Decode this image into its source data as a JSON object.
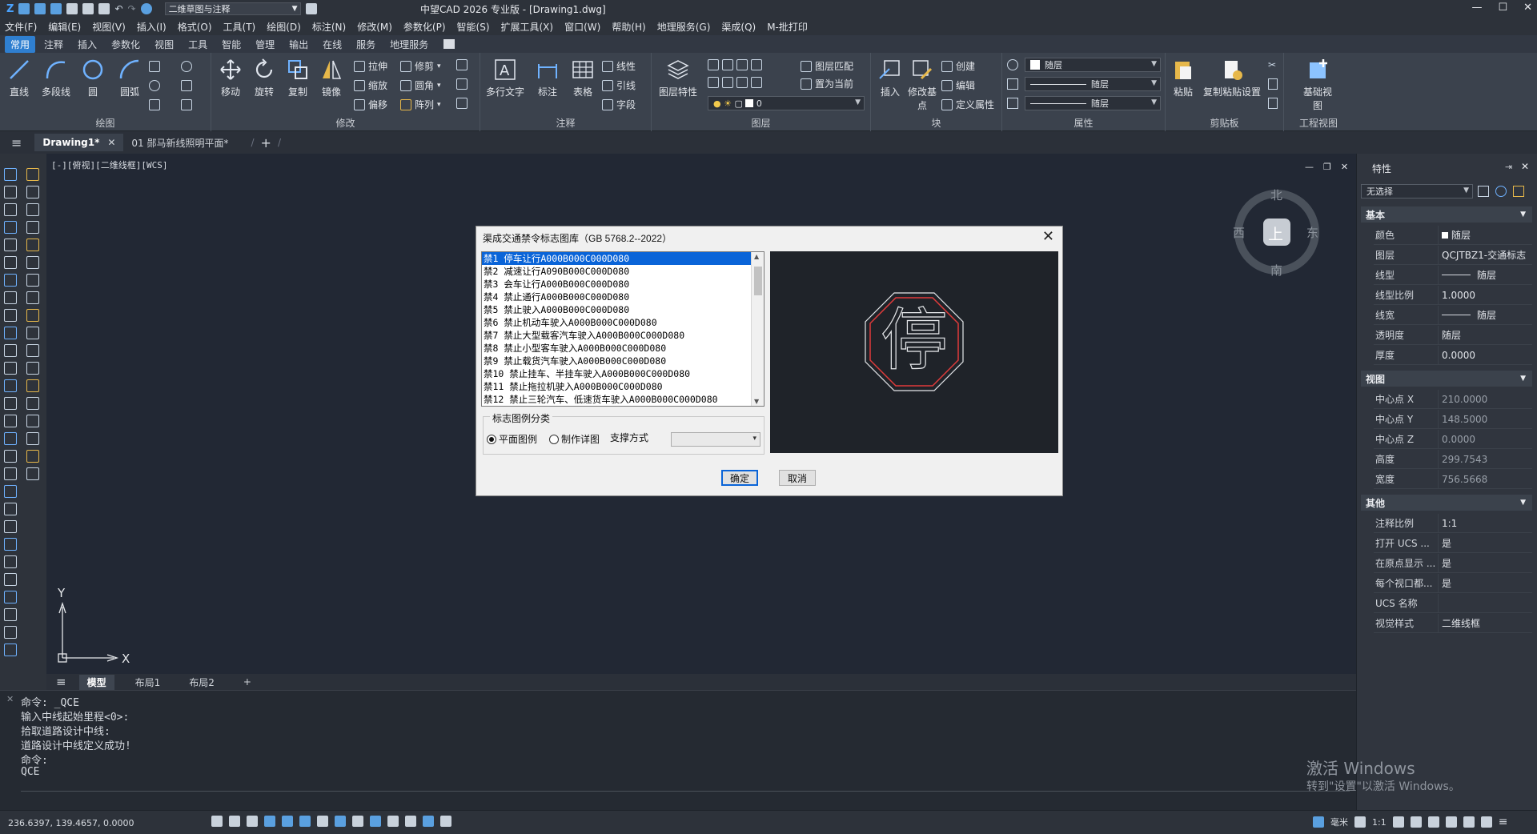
{
  "titlebar": {
    "workspace": "二维草图与注释",
    "title": "中望CAD 2026 专业版 - [Drawing1.dwg]",
    "win_min": "—",
    "win_max": "☐",
    "win_close": "✕"
  },
  "menubar": {
    "items": [
      "文件(F)",
      "编辑(E)",
      "视图(V)",
      "插入(I)",
      "格式(O)",
      "工具(T)",
      "绘图(D)",
      "标注(N)",
      "修改(M)",
      "参数化(P)",
      "智能(S)",
      "扩展工具(X)",
      "窗口(W)",
      "帮助(H)",
      "地理服务(G)",
      "渠成(Q)",
      "M-批打印"
    ]
  },
  "ribbon_tabs": [
    "常用",
    "注释",
    "插入",
    "参数化",
    "视图",
    "工具",
    "智能",
    "管理",
    "输出",
    "在线",
    "服务",
    "地理服务"
  ],
  "ribbon": {
    "draw": {
      "label": "绘图",
      "line": "直线",
      "polyline": "多段线",
      "circle": "圆",
      "arc": "圆弧"
    },
    "modify": {
      "label": "修改",
      "move": "移动",
      "rotate": "旋转",
      "copy": "复制",
      "mirror": "镜像",
      "stretch": "拉伸",
      "scale": "缩放",
      "offset": "偏移",
      "trim": "修剪",
      "fillet": "圆角",
      "array": "阵列"
    },
    "annotate": {
      "label": "注释",
      "mtext": "多行文字",
      "dim": "标注",
      "table": "表格",
      "linear": "线性",
      "leader": "引线",
      "field": "字段"
    },
    "layers": {
      "label": "图层",
      "layer_props": "图层特性",
      "match": "图层匹配",
      "set_current": "置为当前",
      "current_layer": "0"
    },
    "block": {
      "label": "块",
      "insert": "插入",
      "edit_base": "修改基点",
      "create": "创建",
      "edit": "编辑",
      "define_attr": "定义属性"
    },
    "properties": {
      "label": "属性",
      "color": "随层",
      "linetype": "随层",
      "lineweight": "随层"
    },
    "clipboard": {
      "label": "剪贴板",
      "paste": "粘贴",
      "copy_paste_settings": "复制粘贴设置"
    },
    "projview": {
      "label": "工程视图",
      "base_view": "基础视图"
    }
  },
  "doc_tabs": [
    {
      "label": "Drawing1*"
    },
    {
      "label": "01 郧马新线照明平面*"
    }
  ],
  "viewport_label": "[-][俯视][二维线框][WCS]",
  "compass": {
    "north": "北",
    "south": "南",
    "east": "东",
    "west": "西",
    "top": "上"
  },
  "ucs": {
    "x": "X",
    "y": "Y"
  },
  "layout_tabs": [
    "模型",
    "布局1",
    "布局2",
    "+"
  ],
  "command_lines": [
    "命令: _QCE",
    "输入中线起始里程<0>:",
    "拾取道路设计中线:",
    "道路设计中线定义成功!",
    "命令:",
    "QCE"
  ],
  "status": {
    "coords": "236.6397, 139.4657, 0.0000",
    "units": "毫米",
    "scale": "1:1"
  },
  "properties_panel": {
    "title": "特性",
    "selection": "无选择",
    "sections": [
      {
        "name": "基本",
        "rows": [
          [
            "颜色",
            "随层"
          ],
          [
            "图层",
            "QCJTBZ1-交通标志"
          ],
          [
            "线型",
            "随层"
          ],
          [
            "线型比例",
            "1.0000"
          ],
          [
            "线宽",
            "随层"
          ],
          [
            "透明度",
            "随层"
          ],
          [
            "厚度",
            "0.0000"
          ]
        ]
      },
      {
        "name": "视图",
        "rows": [
          [
            "中心点 X",
            "210.0000"
          ],
          [
            "中心点 Y",
            "148.5000"
          ],
          [
            "中心点 Z",
            "0.0000"
          ],
          [
            "高度",
            "299.7543"
          ],
          [
            "宽度",
            "756.5668"
          ]
        ]
      },
      {
        "name": "其他",
        "rows": [
          [
            "注释比例",
            "1:1"
          ],
          [
            "打开 UCS ...",
            "是"
          ],
          [
            "在原点显示 ...",
            "是"
          ],
          [
            "每个视口都...",
            "是"
          ],
          [
            "UCS 名称",
            ""
          ],
          [
            "视觉样式",
            "二维线框"
          ]
        ]
      }
    ]
  },
  "watermark": {
    "line1": "激活 Windows",
    "line2": "转到\"设置\"以激活 Windows。"
  },
  "dialog": {
    "title": "渠成交通禁令标志图库（GB 5768.2--2022）",
    "close": "✕",
    "items": [
      "禁1 停车让行A000B000C000D080",
      "禁2 减速让行A090B000C000D080",
      "禁3 会车让行A000B000C000D080",
      "禁4 禁止通行A000B000C000D080",
      "禁5 禁止驶入A000B000C000D080",
      "禁6 禁止机动车驶入A000B000C000D080",
      "禁7 禁止大型载客汽车驶入A000B000C000D080",
      "禁8 禁止小型客车驶入A000B000C000D080",
      "禁9 禁止载货汽车驶入A000B000C000D080",
      "禁10 禁止挂车、半挂车驶入A000B000C000D080",
      "禁11 禁止拖拉机驶入A000B000C000D080",
      "禁12 禁止三轮汽车、低速货车驶入A000B000C000D080"
    ],
    "selected_index": 0,
    "preview_char": "停",
    "category_label": "标志图例分类",
    "radio_plan": "平面图例",
    "radio_detail": "制作详图",
    "support_label": "支撑方式",
    "support_value": "",
    "ok": "确定",
    "cancel": "取消"
  }
}
